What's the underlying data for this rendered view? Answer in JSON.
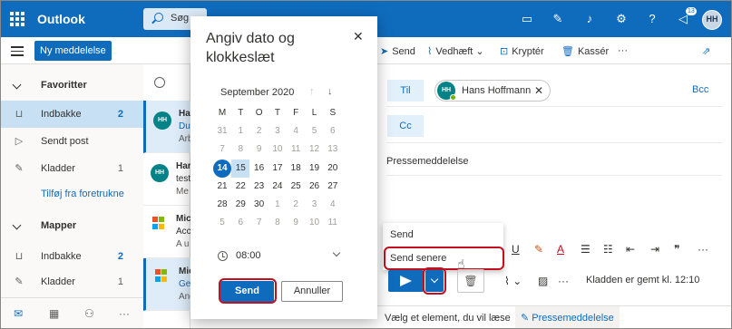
{
  "app": {
    "title": "Outlook",
    "avatar_initials": "HH",
    "notification_count": "13"
  },
  "search": {
    "placeholder": "Søg"
  },
  "toolbar": {
    "new_message": "Ny meddelelse",
    "send": "Send",
    "attach": "Vedhæft",
    "encrypt": "Kryptér",
    "discard": "Kassér",
    "more": "···"
  },
  "sidebar": {
    "favorites": "Favoritter",
    "inbox": "Indbakke",
    "inbox_count": "2",
    "sent": "Sendt post",
    "drafts": "Kladder",
    "drafts_count": "1",
    "add_favorite": "Tilføj fra foretrukne",
    "folders": "Mapper",
    "folder_inbox": "Indbakke",
    "folder_inbox_count": "2",
    "folder_drafts": "Kladder",
    "folder_drafts_count": "1"
  },
  "messages": [
    {
      "initials": "HH",
      "l1": "Har",
      "l2": "Du",
      "l3": "Arb"
    },
    {
      "initials": "HH",
      "l1": "Har",
      "l2": "test",
      "l3": "Me"
    },
    {
      "initials": "",
      "l1": "Mic",
      "l2": "Acc",
      "l3": "A u"
    },
    {
      "initials": "",
      "l1": "Mic",
      "l2": "Get",
      "l3": "And"
    }
  ],
  "compose": {
    "to_label": "Til",
    "cc_label": "Cc",
    "bcc_label": "Bcc",
    "recipient_initials": "HH",
    "recipient_name": "Hans Hoffmann",
    "subject": "Pressemeddelelse",
    "send_menu": [
      "Send",
      "Send senere"
    ],
    "saved_status": "Kladden er gemt kl. 12:10"
  },
  "bottom_tabs": {
    "read": "Vælg et element, du vil læse",
    "draft": "Pressemeddelelse"
  },
  "dialog": {
    "title": "Angiv dato og klokkeslæt",
    "month": "September 2020",
    "weekdays": [
      "M",
      "T",
      "O",
      "T",
      "F",
      "L",
      "S"
    ],
    "weeks": [
      [
        "31",
        "1",
        "2",
        "3",
        "4",
        "5",
        "6"
      ],
      [
        "7",
        "8",
        "9",
        "10",
        "11",
        "12",
        "13"
      ],
      [
        "14",
        "15",
        "16",
        "17",
        "18",
        "19",
        "20"
      ],
      [
        "21",
        "22",
        "23",
        "24",
        "25",
        "26",
        "27"
      ],
      [
        "28",
        "29",
        "30",
        "1",
        "2",
        "3",
        "4"
      ],
      [
        "5",
        "6",
        "7",
        "8",
        "9",
        "10",
        "11"
      ]
    ],
    "today": "14",
    "selected": "15",
    "time": "08:00",
    "send_button": "Send",
    "cancel_button": "Annuller"
  },
  "colors": {
    "brand": "#0f6cbd",
    "highlight": "#c50f1f",
    "presence": "#6bb700"
  }
}
